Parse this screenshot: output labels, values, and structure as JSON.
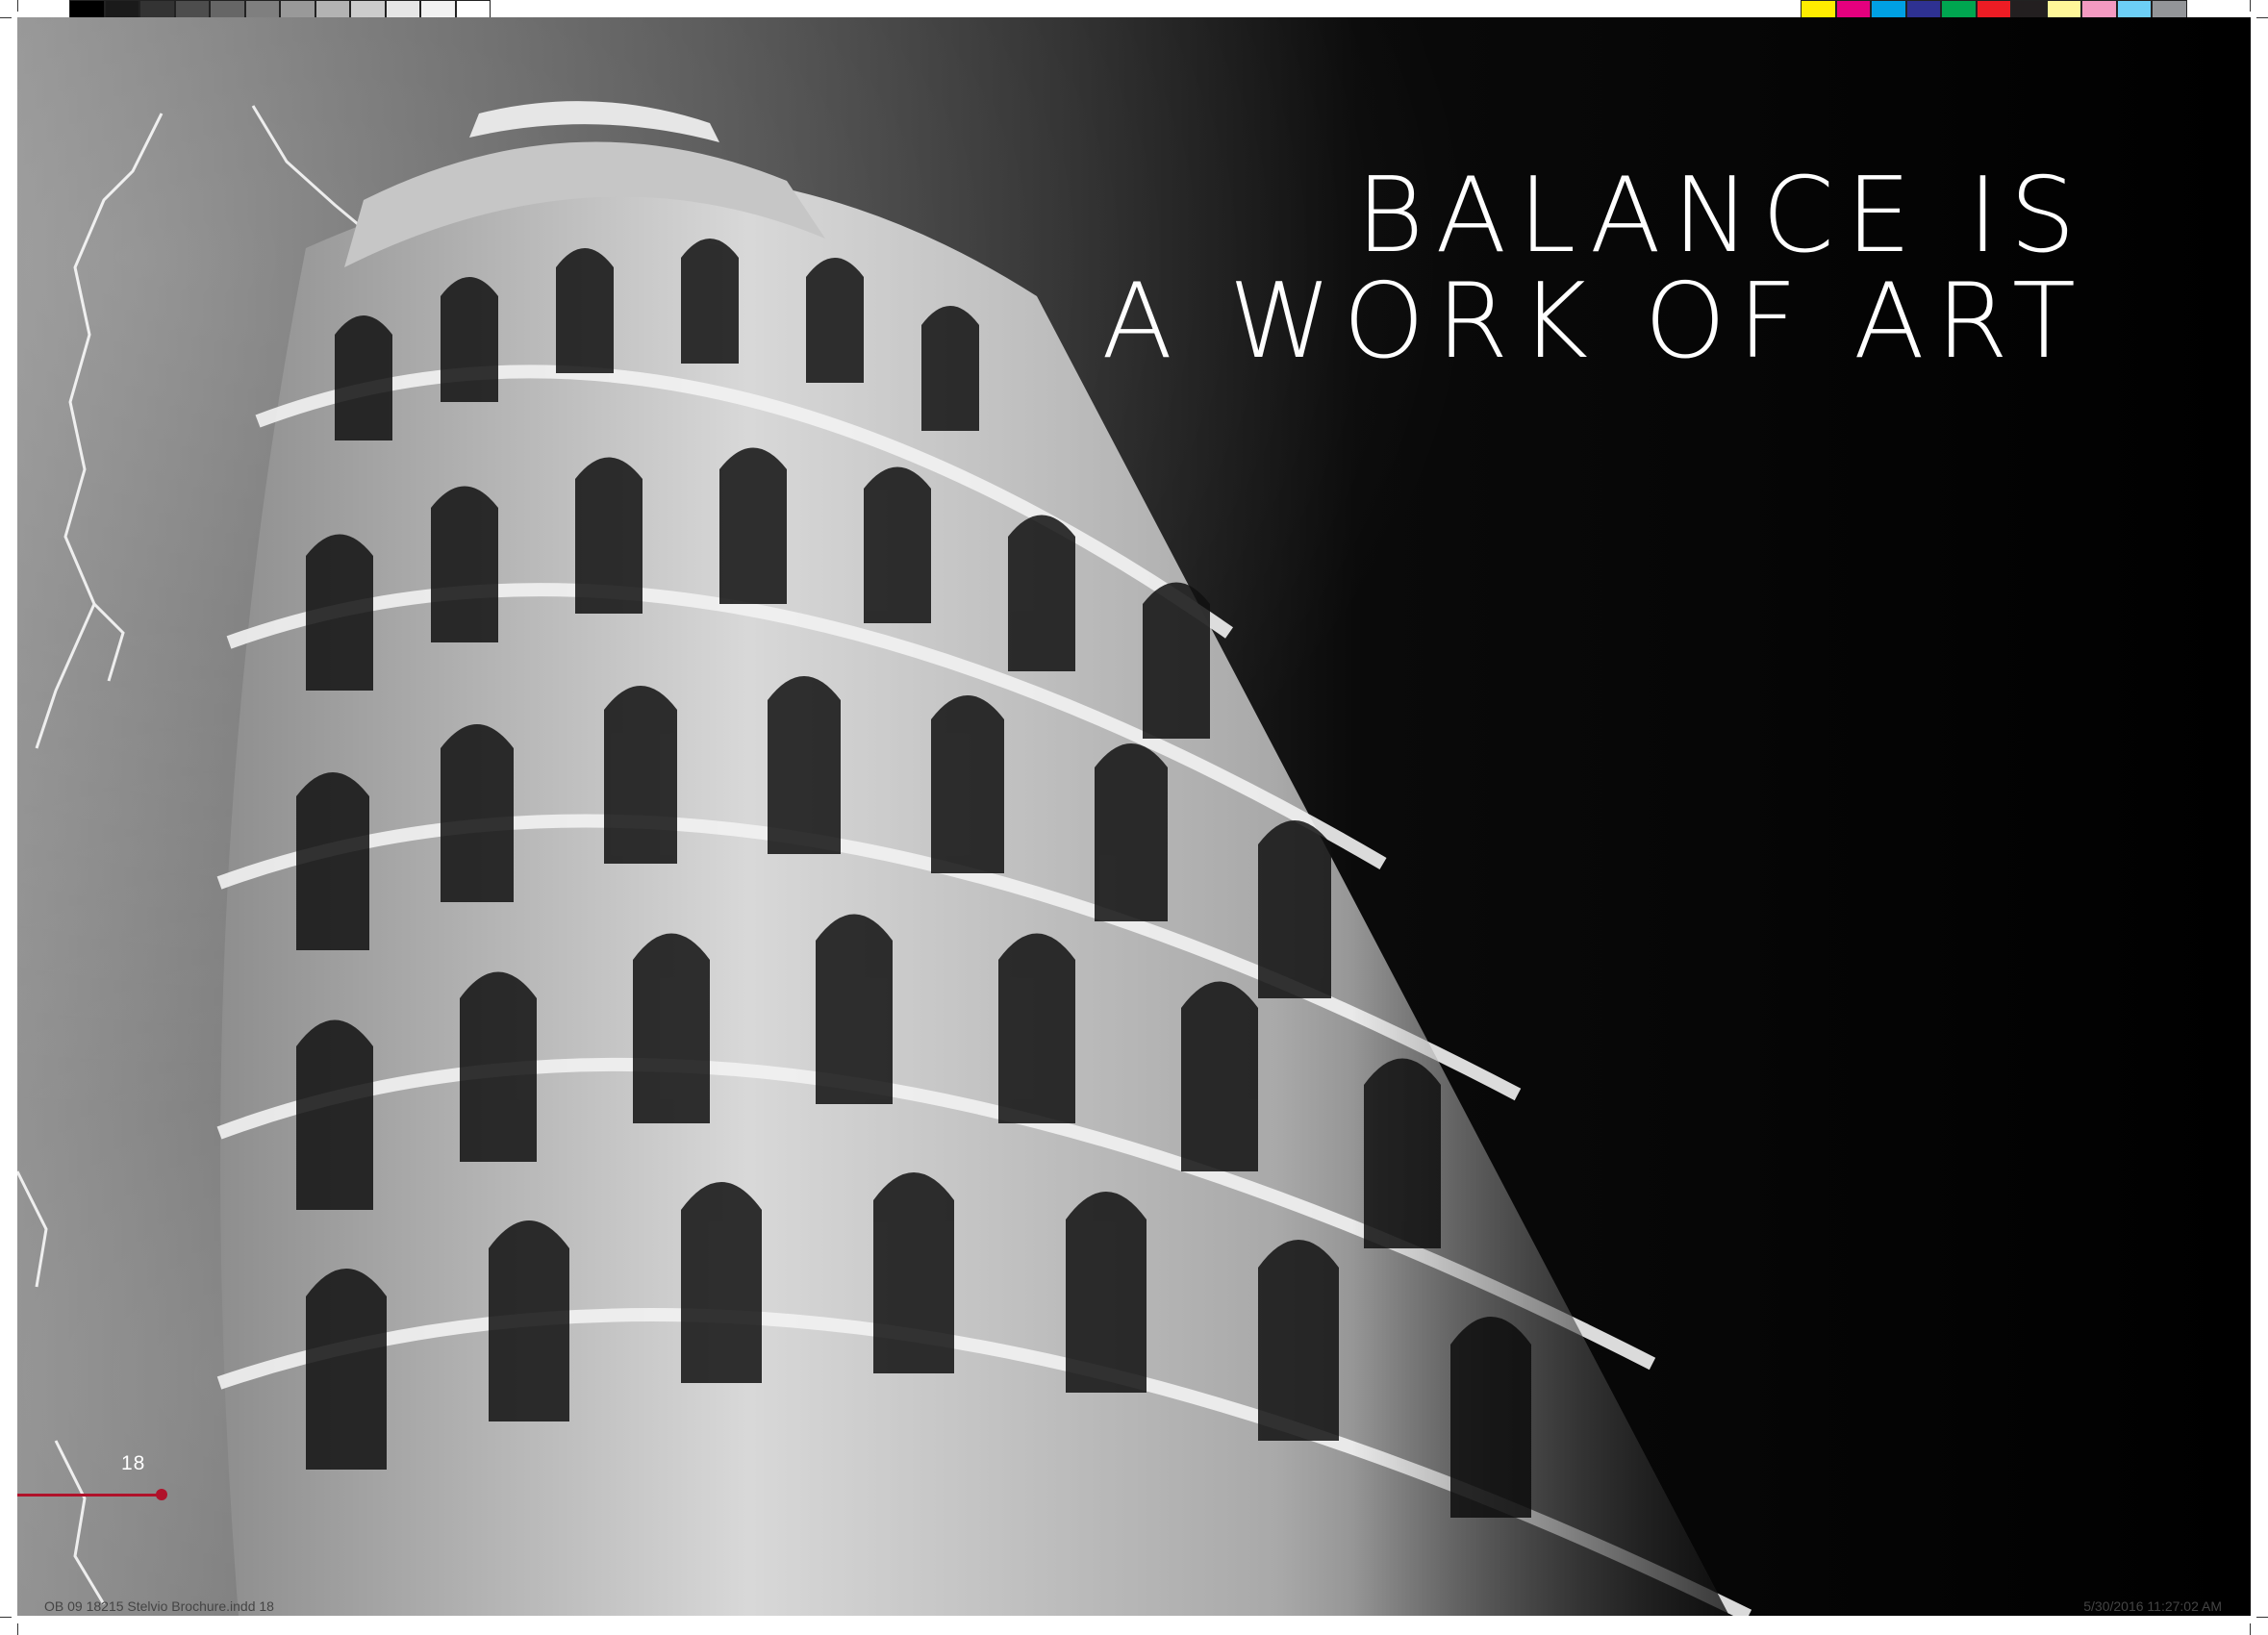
{
  "color_bars": {
    "grays": [
      "#000000",
      "#1a1a1a",
      "#333333",
      "#4d4d4d",
      "#666666",
      "#7f7f7f",
      "#999999",
      "#b3b3b3",
      "#cccccc",
      "#e6e6e6",
      "#f2f2f2",
      "#ffffff"
    ],
    "process": [
      "#ffec00",
      "#e5007e",
      "#00a0e3",
      "#2e3192",
      "#00a650",
      "#ed1c24",
      "#231f20",
      "#fff799",
      "#f49ac1",
      "#6dcff6",
      "#939598"
    ]
  },
  "spread": {
    "headline": {
      "line1": "BALANCE IS",
      "line2": "A WORK OF ART"
    },
    "page_number": "18",
    "accent_color": "#b0122a",
    "photo_subject_icon": "leaning-tower-icon",
    "lightning_icon": "lightning-bolt-icon"
  },
  "slug": {
    "file": "OB 09 18215 Stelvio Brochure.indd 18",
    "timestamp": "5/30/2016 11:27:02 AM"
  }
}
